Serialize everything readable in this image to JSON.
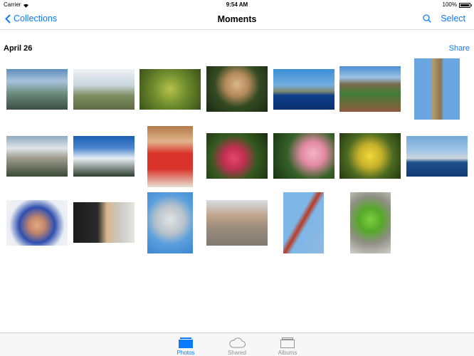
{
  "status": {
    "carrier": "Carrier",
    "time": "9:54 AM",
    "battery": "100%"
  },
  "nav": {
    "back_label": "Collections",
    "title": "Moments",
    "select_label": "Select"
  },
  "section": {
    "date": "April 26",
    "share_label": "Share"
  },
  "tabs": [
    {
      "label": "Photos",
      "active": true
    },
    {
      "label": "Shared",
      "active": false
    },
    {
      "label": "Albums",
      "active": false
    }
  ],
  "colors": {
    "accent": "#0a7aff",
    "inactive": "#929292"
  }
}
